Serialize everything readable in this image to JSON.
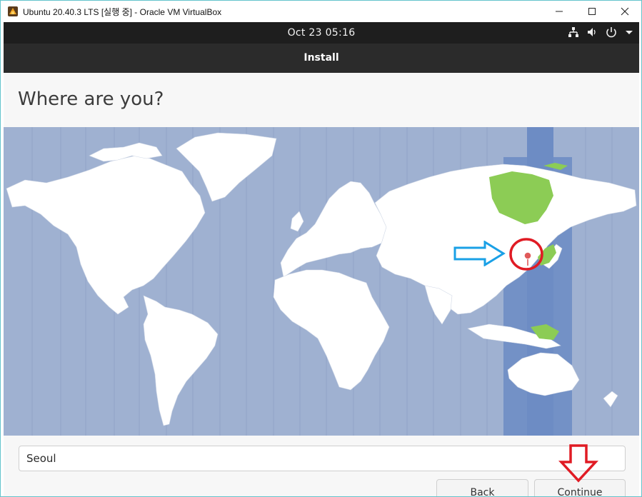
{
  "host_window": {
    "title": "Ubuntu 20.40.3 LTS [실행 중] - Oracle VM VirtualBox",
    "controls": {
      "minimize": "—",
      "maximize": "☐",
      "close": "✕"
    }
  },
  "topbar": {
    "clock": "Oct 23  05:16",
    "icons": [
      "network-icon",
      "volume-icon",
      "power-icon",
      "chevron-down-icon"
    ]
  },
  "header": {
    "title": "Install"
  },
  "page": {
    "heading": "Where are you?",
    "location_value": "Seoul",
    "back_label": "Back",
    "continue_label": "Continue"
  },
  "map": {
    "ocean_color": "#9fb1d1",
    "land_color": "#ffffff",
    "selected_timezone_color": "#7391c6",
    "highlight_color": "#8ccc55",
    "pin_color": "#e05a5a"
  },
  "annotations": {
    "arrow_color": "#1aa0e6",
    "circle_color": "#e01b24",
    "down_arrow_color": "#e01b24"
  }
}
